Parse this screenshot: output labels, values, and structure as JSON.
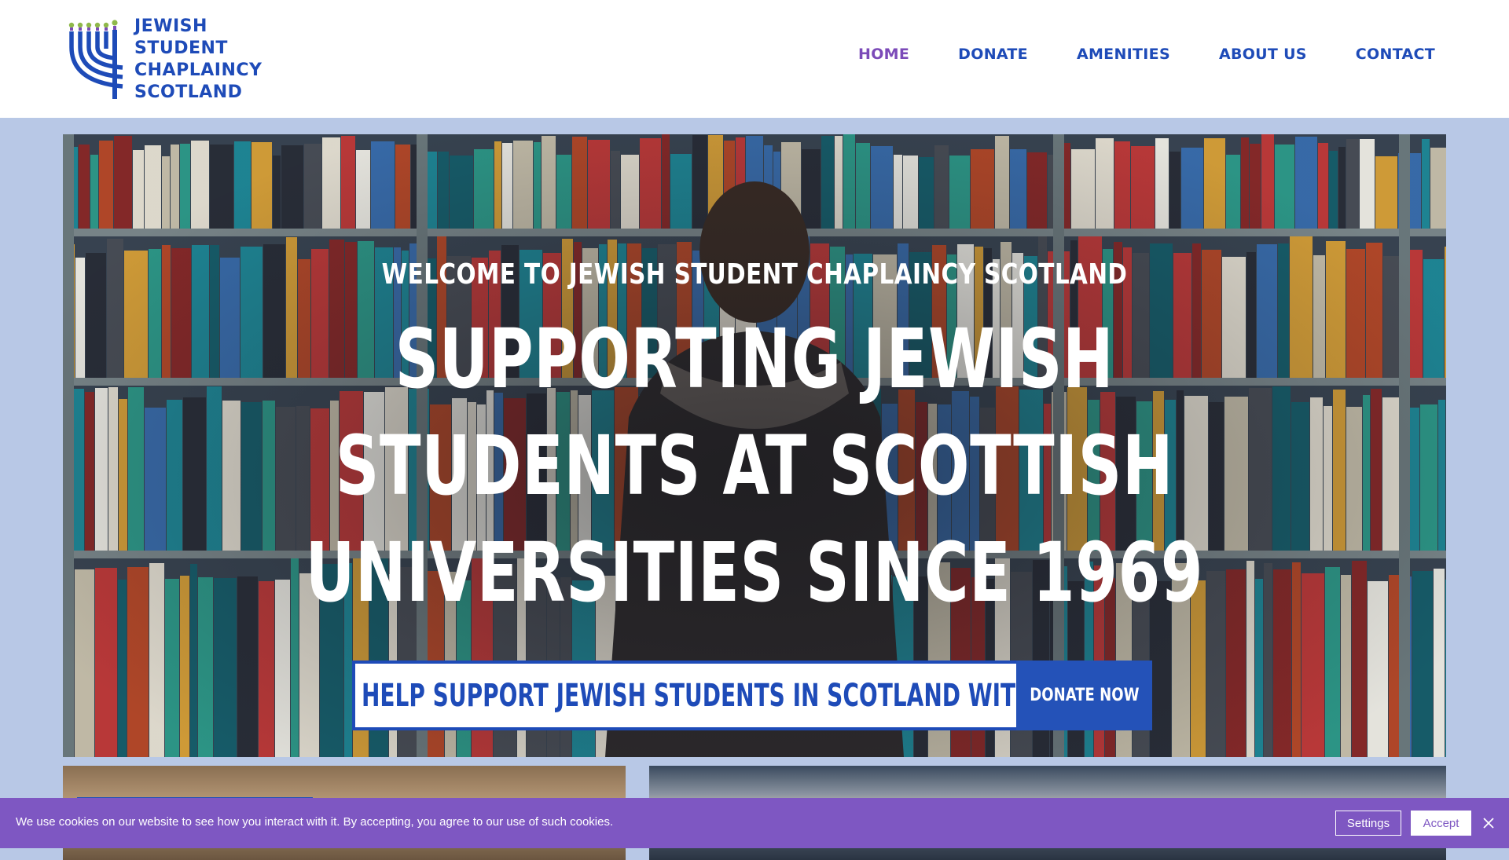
{
  "brand": {
    "logo_lines": [
      "JEWISH",
      "STUDENT",
      "CHAPLAINCY",
      "SCOTLAND"
    ],
    "primary_color": "#1e4bb8",
    "accent_color": "#7b4ab8"
  },
  "nav": {
    "items": [
      {
        "label": "HOME",
        "active": true
      },
      {
        "label": "DONATE",
        "active": false
      },
      {
        "label": "AMENITIES",
        "active": false
      },
      {
        "label": "ABOUT US",
        "active": false
      },
      {
        "label": "CONTACT",
        "active": false
      }
    ]
  },
  "hero": {
    "eyebrow": "WELCOME TO JEWISH STUDENT CHAPLAINCY SCOTLAND",
    "headline_lines": [
      "SUPPORTING JEWISH",
      "STUDENTS AT SCOTTISH",
      "UNIVERSITIES SINCE 1969"
    ],
    "cta_text": "HELP SUPPORT JEWISH STUDENTS IN SCOTLAND WITH A GIFT",
    "cta_button": "DONATE NOW",
    "background": "library-bookshelves-photo"
  },
  "cookie_bar": {
    "message": "We use cookies on our website to see how you interact with it. By accepting, you agree to our use of such cookies.",
    "settings_label": "Settings",
    "accept_label": "Accept",
    "bar_color": "#7e57c2",
    "close_icon": "close-icon"
  }
}
